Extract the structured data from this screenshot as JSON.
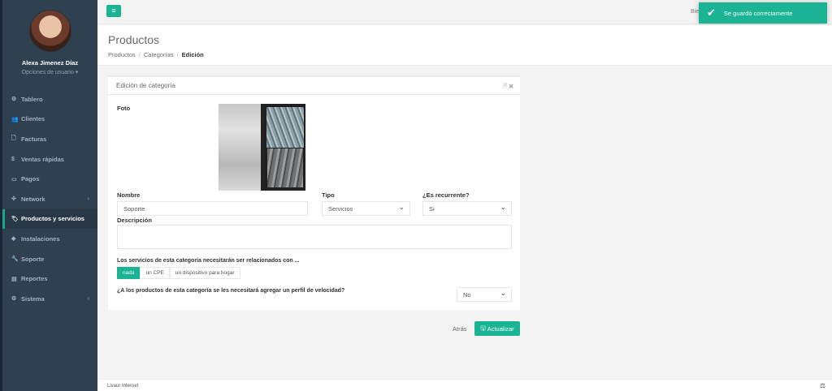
{
  "user": {
    "name": "Alexa Jimenez Díaz",
    "options_label": "Opciones de usuario ▾"
  },
  "nav": [
    {
      "label": "Tablero",
      "icon": "⚙"
    },
    {
      "label": "Clientes",
      "icon": "👥"
    },
    {
      "label": "Facturas",
      "icon": "🗋"
    },
    {
      "label": "Ventas rápidas",
      "icon": "$"
    },
    {
      "label": "Pagos",
      "icon": "▭"
    },
    {
      "label": "Network",
      "icon": "✣",
      "caret": "‹"
    },
    {
      "label": "Productos y servicios",
      "icon": "🏷"
    },
    {
      "label": "Instalaciones",
      "icon": "◆"
    },
    {
      "label": "Soporte",
      "icon": "🔧"
    },
    {
      "label": "Reportes",
      "icon": "▤"
    },
    {
      "label": "Sistema",
      "icon": "⚙",
      "caret": "‹"
    }
  ],
  "topbar": {
    "menu_icon": "≡",
    "welcome": "Bien"
  },
  "toast": {
    "message": "Se guardó correctamente",
    "icon": "✔"
  },
  "heading": {
    "title": "Productos",
    "crumb1": "Productos",
    "crumb2": "Categorías",
    "crumb3": "Edición",
    "sep": "/"
  },
  "panel": {
    "title": "Edición de categoría",
    "tools": "🗎 ✖",
    "foto_label": "Foto",
    "nombre_label": "Nombre",
    "nombre_value": "Soporte",
    "tipo_label": "Tipo",
    "tipo_value": "Servicios",
    "recurrente_label": "¿Es recurrente?",
    "recurrente_value": "Si",
    "descripcion_label": "Descripción",
    "relacion_label": "Los servicios de esta categoría necesitarán ser relacionados con ...",
    "relacion_options": [
      "nada",
      "un CPE",
      "un dispositivo para hogar"
    ],
    "velocidad_label": "¿A los productos de esta categoría se les necesitará agregar un perfil de velocidad?",
    "velocidad_value": "No"
  },
  "actions": {
    "back": "Atrás",
    "update": "Actualizar",
    "update_icon": "🖫"
  },
  "footer": {
    "text": "Livaur Internet",
    "icon": "⚖"
  }
}
